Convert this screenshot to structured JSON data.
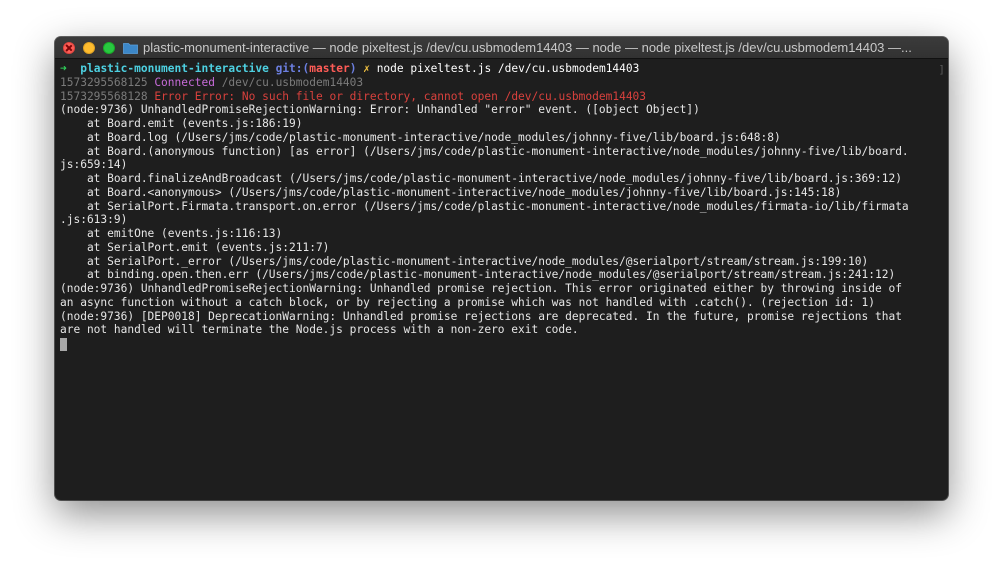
{
  "window": {
    "title": "plastic-monument-interactive — node pixeltest.js /dev/cu.usbmodem14403 — node — node pixeltest.js /dev/cu.usbmodem14403 —..."
  },
  "prompt": {
    "arrow": "➜",
    "directory": "plastic-monument-interactive",
    "git_prefix": "git:(",
    "branch": "master",
    "git_suffix": ")",
    "dirty_marker": "✗",
    "command": "node pixeltest.js /dev/cu.usbmodem14403"
  },
  "log": {
    "connected": {
      "timestamp": "1573295568125",
      "label": "Connected",
      "message": "/dev/cu.usbmodem14403"
    },
    "error": {
      "timestamp": "1573295568128",
      "label": "Error",
      "message": "Error: No such file or directory, cannot open /dev/cu.usbmodem14403"
    }
  },
  "output_lines": [
    "(node:9736) UnhandledPromiseRejectionWarning: Error: Unhandled \"error\" event. ([object Object])",
    "    at Board.emit (events.js:186:19)",
    "    at Board.log (/Users/jms/code/plastic-monument-interactive/node_modules/johnny-five/lib/board.js:648:8)",
    "    at Board.(anonymous function) [as error] (/Users/jms/code/plastic-monument-interactive/node_modules/johnny-five/lib/board.",
    "js:659:14)",
    "    at Board.finalizeAndBroadcast (/Users/jms/code/plastic-monument-interactive/node_modules/johnny-five/lib/board.js:369:12)",
    "    at Board.<anonymous> (/Users/jms/code/plastic-monument-interactive/node_modules/johnny-five/lib/board.js:145:18)",
    "    at SerialPort.Firmata.transport.on.error (/Users/jms/code/plastic-monument-interactive/node_modules/firmata-io/lib/firmata",
    ".js:613:9)",
    "    at emitOne (events.js:116:13)",
    "    at SerialPort.emit (events.js:211:7)",
    "    at SerialPort._error (/Users/jms/code/plastic-monument-interactive/node_modules/@serialport/stream/stream.js:199:10)",
    "    at binding.open.then.err (/Users/jms/code/plastic-monument-interactive/node_modules/@serialport/stream/stream.js:241:12)",
    "(node:9736) UnhandledPromiseRejectionWarning: Unhandled promise rejection. This error originated either by throwing inside of",
    "an async function without a catch block, or by rejecting a promise which was not handled with .catch(). (rejection id: 1)",
    "(node:9736) [DEP0018] DeprecationWarning: Unhandled promise rejections are deprecated. In the future, promise rejections that",
    "are not handled will terminate the Node.js process with a non-zero exit code."
  ],
  "scroll_indicator": "]",
  "colors": {
    "background": "#1e1e1e",
    "prompt_arrow": "#2fd15a",
    "directory": "#4dd0e1",
    "git": "#6c7fe0",
    "branch": "#ff5c57",
    "dirty": "#f0c040",
    "timestamp": "#7a7a7a",
    "connected": "#c66bd8",
    "error": "#d8413d"
  }
}
